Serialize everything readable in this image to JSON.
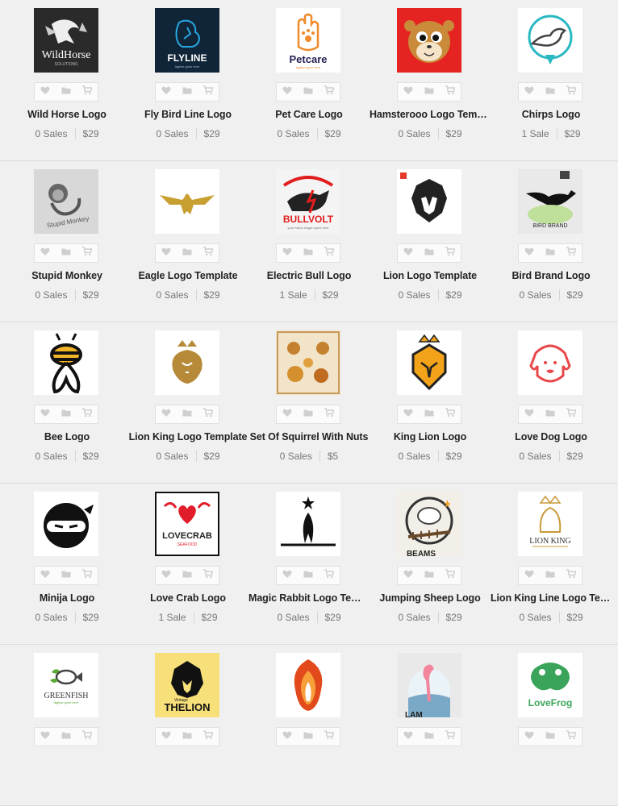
{
  "icons": {
    "like": "heart-icon",
    "collection": "folder-icon",
    "cart": "cart-icon"
  },
  "rows": [
    [
      {
        "title": "Wild Horse Logo",
        "sales": "0 Sales",
        "price": "$29",
        "logo_text": "WildHorse",
        "logo_sub": "SOLUTIONS"
      },
      {
        "title": "Fly Bird Line Logo",
        "sales": "0 Sales",
        "price": "$29",
        "logo_text": "FLYLINE",
        "logo_sub": "tagline goes here"
      },
      {
        "title": "Pet Care Logo",
        "sales": "0 Sales",
        "price": "$29",
        "logo_text": "Petcare",
        "logo_sub": "tagline goes here"
      },
      {
        "title": "Hamsterooo Logo Template",
        "sales": "0 Sales",
        "price": "$29"
      },
      {
        "title": "Chirps Logo",
        "sales": "1 Sale",
        "price": "$29"
      }
    ],
    [
      {
        "title": "Stupid Monkey",
        "sales": "0 Sales",
        "price": "$29",
        "logo_text": "Stupid Monkey"
      },
      {
        "title": "Eagle Logo Template",
        "sales": "0 Sales",
        "price": "$29"
      },
      {
        "title": "Electric Bull Logo",
        "sales": "1 Sale",
        "price": "$29",
        "logo_text": "BULLVOLT",
        "logo_sub": "your brand slogan goes here"
      },
      {
        "title": "Lion Logo Template",
        "sales": "0 Sales",
        "price": "$29"
      },
      {
        "title": "Bird Brand Logo",
        "sales": "0 Sales",
        "price": "$29",
        "logo_text": "BIRD BRAND"
      }
    ],
    [
      {
        "title": "Bee Logo",
        "sales": "0 Sales",
        "price": "$29"
      },
      {
        "title": "Lion King Logo Template",
        "sales": "0 Sales",
        "price": "$29"
      },
      {
        "title": "Set Of Squirrel With Nuts",
        "sales": "0 Sales",
        "price": "$5"
      },
      {
        "title": "King Lion Logo",
        "sales": "0 Sales",
        "price": "$29"
      },
      {
        "title": "Love Dog Logo",
        "sales": "0 Sales",
        "price": "$29"
      }
    ],
    [
      {
        "title": "Minija Logo",
        "sales": "0 Sales",
        "price": "$29"
      },
      {
        "title": "Love Crab Logo",
        "sales": "1 Sale",
        "price": "$29",
        "logo_text": "LOVECRAB",
        "logo_sub": "SEAFOOD"
      },
      {
        "title": "Magic Rabbit Logo Template",
        "sales": "0 Sales",
        "price": "$29"
      },
      {
        "title": "Jumping Sheep Logo",
        "sales": "0 Sales",
        "price": "$29",
        "logo_text": "BEAMS"
      },
      {
        "title": "Lion King Line Logo Template",
        "sales": "0 Sales",
        "price": "$29",
        "logo_text": "LION KING"
      }
    ],
    [
      {
        "title": "",
        "sales": "",
        "price": "",
        "logo_text": "GREENFISH",
        "logo_sub": "tagline goes here"
      },
      {
        "title": "",
        "sales": "",
        "price": "",
        "logo_text": "THELION",
        "logo_sub": "Vintage"
      },
      {
        "title": "",
        "sales": "",
        "price": ""
      },
      {
        "title": "",
        "sales": "",
        "price": "",
        "logo_text": "LAM"
      },
      {
        "title": "",
        "sales": "",
        "price": "",
        "logo_text": "LoveFrog"
      }
    ]
  ]
}
